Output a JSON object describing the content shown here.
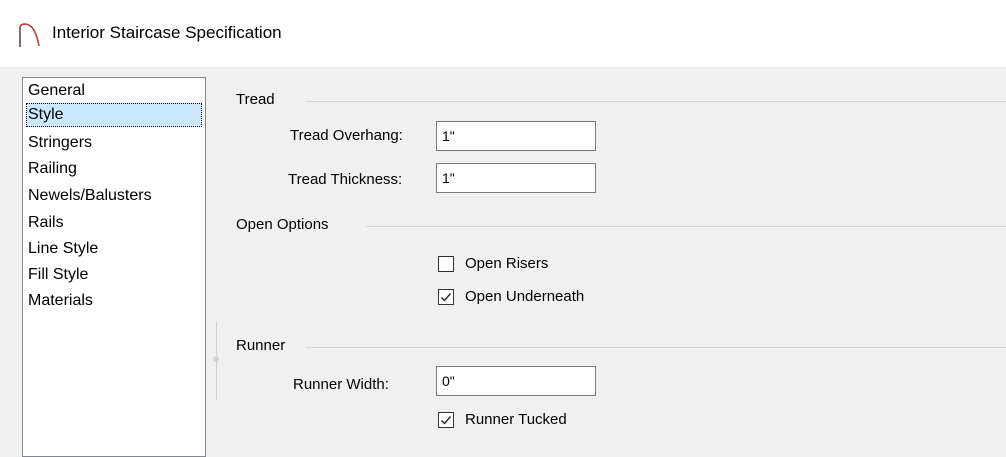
{
  "window": {
    "title": "Interior Staircase Specification"
  },
  "nav": {
    "items": [
      {
        "label": "General",
        "selected": false
      },
      {
        "label": "Style",
        "selected": true
      },
      {
        "label": "Stringers",
        "selected": false
      },
      {
        "label": "Railing",
        "selected": false
      },
      {
        "label": "Newels/Balusters",
        "selected": false
      },
      {
        "label": "Rails",
        "selected": false
      },
      {
        "label": "Line Style",
        "selected": false
      },
      {
        "label": "Fill Style",
        "selected": false
      },
      {
        "label": "Materials",
        "selected": false
      }
    ]
  },
  "tread": {
    "group_label": "Tread",
    "overhang_label": "Tread Overhang:",
    "overhang_value": "1\"",
    "thickness_label": "Tread Thickness:",
    "thickness_value": "1\""
  },
  "open_options": {
    "group_label": "Open Options",
    "open_risers_label": "Open Risers",
    "open_risers_checked": false,
    "open_underneath_label": "Open Underneath",
    "open_underneath_checked": true
  },
  "runner": {
    "group_label": "Runner",
    "width_label": "Runner Width:",
    "width_value": "0\"",
    "tucked_label": "Runner Tucked",
    "tucked_checked": true
  },
  "colors": {
    "selection_bg": "#cce8ff",
    "app_icon": "#c0392b"
  },
  "icons": {
    "app": "staircase-arc-icon",
    "check": "checkmark-icon"
  }
}
